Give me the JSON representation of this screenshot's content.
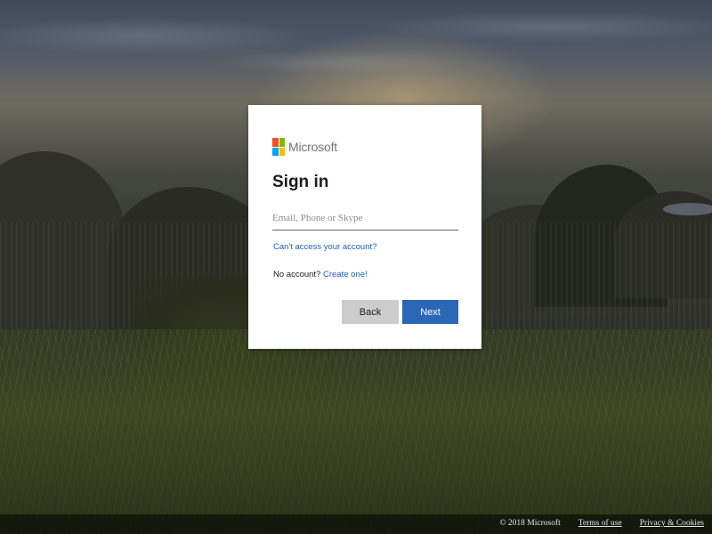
{
  "brand": {
    "name": "Microsoft",
    "logo_colors": [
      "#f25022",
      "#7fba00",
      "#00a4ef",
      "#ffb900"
    ]
  },
  "signin": {
    "title": "Sign in",
    "email_placeholder": "Email, Phone or Skype",
    "email_value": "",
    "cant_access_link": "Can't access your account?",
    "no_account_text": "No account?",
    "create_link": "Create one!",
    "back_button": "Back",
    "next_button": "Next"
  },
  "footer": {
    "copyright": "© 2018 Microsoft",
    "terms": "Terms of use",
    "privacy": "Privacy & Cookies"
  },
  "colors": {
    "accent": "#2b66b7",
    "link": "#1a5fb4",
    "back_button_bg": "#cccccc"
  }
}
